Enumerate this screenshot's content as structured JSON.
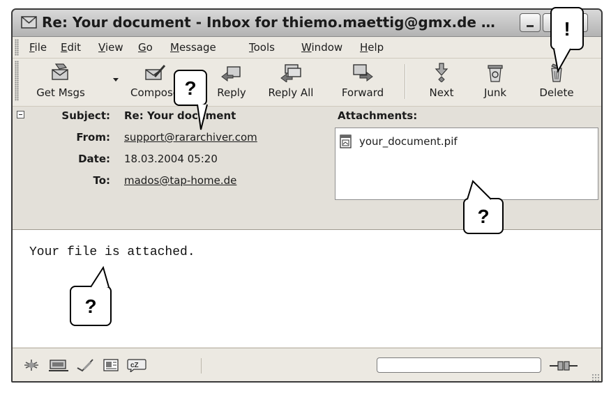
{
  "window": {
    "title": "Re: Your document - Inbox for thiemo.maettig@gmx.de …",
    "close_glyph": "✕"
  },
  "menu": {
    "items": [
      {
        "label": "File",
        "u": "F",
        "rest": "ile"
      },
      {
        "label": "Edit",
        "u": "E",
        "rest": "dit"
      },
      {
        "label": "View",
        "u": "V",
        "rest": "iew"
      },
      {
        "label": "Go",
        "u": "G",
        "rest": "o"
      },
      {
        "label": "Message",
        "u": "M",
        "rest": "essage"
      },
      {
        "label": "Tools",
        "u": "T",
        "rest": "ools"
      },
      {
        "label": "Window",
        "u": "W",
        "rest": "indow"
      },
      {
        "label": "Help",
        "u": "H",
        "rest": "elp"
      }
    ]
  },
  "toolbar": {
    "get_msgs": "Get Msgs",
    "compose": "Compose",
    "reply": "Reply",
    "reply_all": "Reply All",
    "forward": "Forward",
    "next": "Next",
    "junk": "Junk",
    "delete": "Delete"
  },
  "message": {
    "subject_label": "Subject:",
    "subject": "Re: Your document",
    "from_label": "From:",
    "from": "support@rararchiver.com",
    "date_label": "Date:",
    "date": "18.03.2004 05:20",
    "to_label": "To:",
    "to": "mados@tap-home.de",
    "attachments_label": "Attachments:",
    "attachment_name": "your_document.pif",
    "body": "Your file is attached."
  },
  "callouts": {
    "compose": "?",
    "attachment": "?",
    "body": "?",
    "delete": "!"
  },
  "colors": {
    "window_bg": "#ece9e2",
    "header_bg": "#e3e0d9",
    "body_bg": "#ffffff",
    "text": "#1b1b1b"
  }
}
